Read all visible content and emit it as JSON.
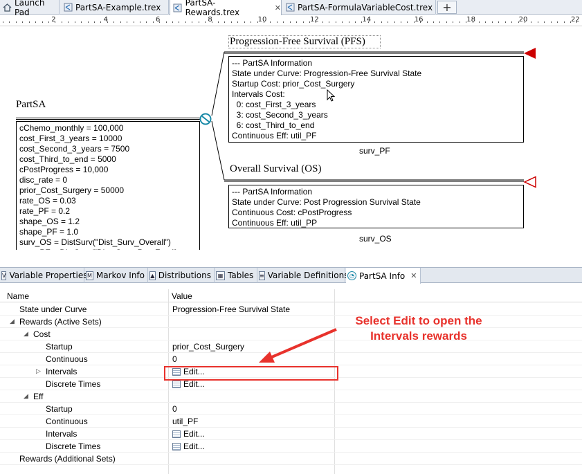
{
  "tabs": [
    {
      "label": "Launch Pad",
      "icon": "home-icon"
    },
    {
      "label": "PartSA-Example.trex",
      "icon": "tree-file-icon"
    },
    {
      "label": "PartSA-Rewards.trex",
      "icon": "tree-file-icon",
      "active": true
    },
    {
      "label": "PartSA-FormulaVariableCost.trex",
      "icon": "tree-file-icon"
    }
  ],
  "tab_close_glyph": "✕",
  "new_tab_glyph": "+",
  "ruler": {
    "labels": [
      "2",
      "4",
      "6",
      "8",
      "10",
      "12",
      "14",
      "16",
      "18",
      "20",
      "22"
    ]
  },
  "canvas": {
    "root_title": "PartSA",
    "root_variables": "cChemo_monthly = 100,000\ncost_First_3_years = 10000\ncost_Second_3_years = 7500\ncost_Third_to_end = 5000\ncPostProgress = 10,000\ndisc_rate = 0\nprior_Cost_Surgery = 50000\nrate_OS = 0.03\nrate_PF = 0.2\nshape_OS = 1.2\nshape_PF = 1.0\nsurv_OS = DistSurv(\"Dist_Surv_Overall\")\nsurv_PF = DistSurv(\"Dist_Surv_ProgFree\")",
    "pfs_title": "Progression-Free Survival (PFS)",
    "pfs_info": "--- PartSA Information\nState under Curve: Progression-Free Survival State\nStartup Cost: prior_Cost_Surgery\nIntervals Cost:\n  0: cost_First_3_years\n  3: cost_Second_3_years\n  6: cost_Third_to_end\nContinuous Eff: util_PF",
    "pfs_label": "surv_PF",
    "os_title": "Overall Survival (OS)",
    "os_info": "--- PartSA Information\nState under Curve: Post Progression Survival State\nContinuous Cost: cPostProgress\nContinuous Eff: util_PP",
    "os_label": "surv_OS",
    "terminal_color": "#cc0000",
    "node_color": "#1a8aa8"
  },
  "view_tabs": [
    {
      "label": "Variable Properties",
      "icon": "variable-icon"
    },
    {
      "label": "Markov Info",
      "icon": "markov-icon"
    },
    {
      "label": "Distributions",
      "icon": "distribution-icon"
    },
    {
      "label": "Tables",
      "icon": "table-icon"
    },
    {
      "label": "Variable Definitions",
      "icon": "definitions-icon"
    },
    {
      "label": "PartSA Info",
      "icon": "partsa-icon",
      "active": true
    }
  ],
  "properties": {
    "col_name": "Name",
    "col_value": "Value",
    "rows": [
      {
        "name": "State under Curve",
        "value": "Progression-Free Survival State",
        "level": 0
      },
      {
        "name": "Rewards (Active Sets)",
        "value": "",
        "level": 0,
        "expanded": true
      },
      {
        "name": "Cost",
        "value": "",
        "level": 1,
        "expanded": true
      },
      {
        "name": "Startup",
        "value": "prior_Cost_Surgery",
        "level": 2
      },
      {
        "name": "Continuous",
        "value": "0",
        "level": 2
      },
      {
        "name": "Intervals",
        "value": "Edit...",
        "level": 2,
        "collapsed": true,
        "edit": true
      },
      {
        "name": "Discrete Times",
        "value": "Edit...",
        "level": 2,
        "edit": true
      },
      {
        "name": "Eff",
        "value": "",
        "level": 1,
        "expanded": true
      },
      {
        "name": "Startup",
        "value": "0",
        "level": 2
      },
      {
        "name": "Continuous",
        "value": "util_PF",
        "level": 2
      },
      {
        "name": "Intervals",
        "value": "Edit...",
        "level": 2,
        "edit": true
      },
      {
        "name": "Discrete Times",
        "value": "Edit...",
        "level": 2,
        "edit": true
      },
      {
        "name": "Rewards (Additional Sets)",
        "value": "",
        "level": 0
      }
    ]
  },
  "annotation": {
    "text": "Select Edit to open the Intervals rewards",
    "color": "#e8322c"
  }
}
